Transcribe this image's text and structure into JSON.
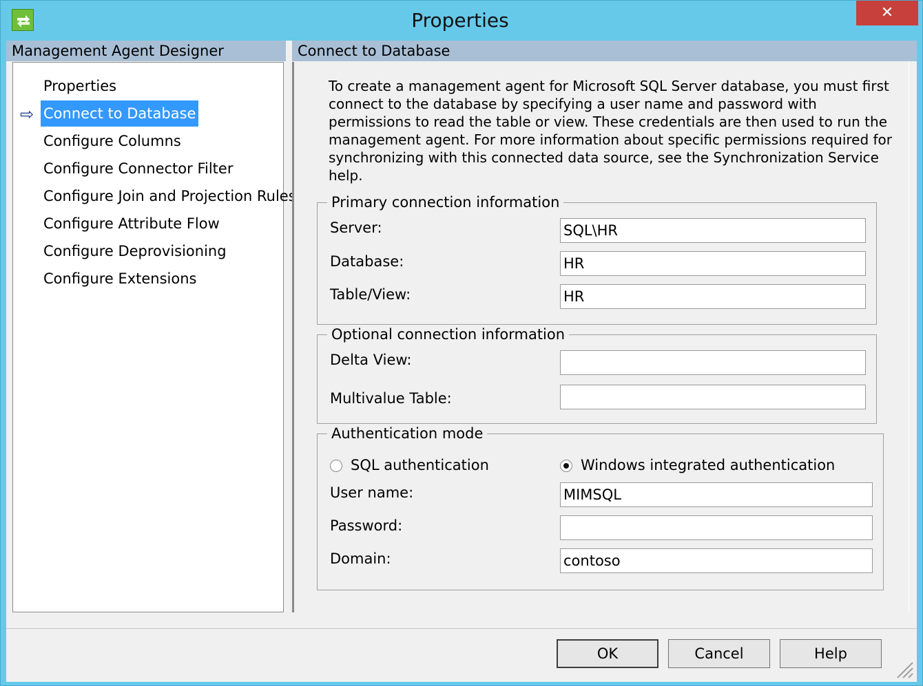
{
  "window": {
    "title": "Properties",
    "close_label": "✕"
  },
  "left": {
    "header": "Management Agent Designer",
    "items": [
      {
        "label": "Properties"
      },
      {
        "label": "Connect to Database"
      },
      {
        "label": "Configure Columns"
      },
      {
        "label": "Configure Connector Filter"
      },
      {
        "label": "Configure Join and Projection Rules"
      },
      {
        "label": "Configure Attribute Flow"
      },
      {
        "label": "Configure Deprovisioning"
      },
      {
        "label": "Configure Extensions"
      }
    ],
    "active_arrow": "⇨"
  },
  "right": {
    "header": "Connect to Database",
    "intro": "To create a management agent for Microsoft SQL Server database, you must first connect to the database by specifying a user name and password with permissions to read the table or view. These credentials are then used to run the management agent. For more information about specific permissions required for synchronizing with this connected data source, see the Synchronization Service help.",
    "primary": {
      "title": "Primary connection information",
      "server_label": "Server:",
      "server_value": "SQL\\HR",
      "database_label": "Database:",
      "database_value": "HR",
      "table_label": "Table/View:",
      "table_value": "HR"
    },
    "optional": {
      "title": "Optional connection information",
      "delta_label": "Delta View:",
      "delta_value": "",
      "multivalue_label": "Multivalue Table:",
      "multivalue_value": ""
    },
    "auth": {
      "title": "Authentication mode",
      "sql_label": "SQL authentication",
      "windows_label": "Windows integrated authentication",
      "selected": "windows",
      "username_label": "User name:",
      "username_value": "MIMSQL",
      "password_label": "Password:",
      "password_value": "",
      "domain_label": "Domain:",
      "domain_value": "contoso"
    }
  },
  "buttons": {
    "ok": "OK",
    "cancel": "Cancel",
    "help": "Help"
  },
  "colors": {
    "titlebar": "#66c9ea",
    "close": "#c7403b",
    "header": "#a9bfd6",
    "selection": "#3399ff"
  }
}
